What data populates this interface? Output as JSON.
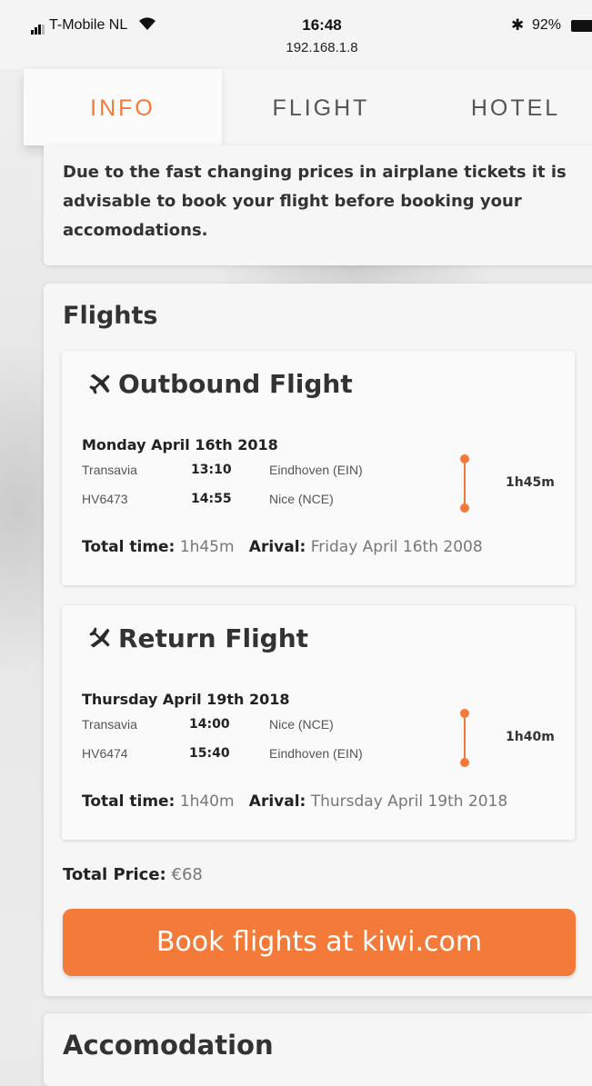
{
  "status_bar": {
    "carrier": "T-Mobile NL",
    "time": "16:48",
    "url": "192.168.1.8",
    "bluetooth": "✱",
    "battery": "92%"
  },
  "tabs": [
    {
      "label": "INFO",
      "active": true
    },
    {
      "label": "FLIGHT",
      "active": false
    },
    {
      "label": "HOTEL",
      "active": false
    }
  ],
  "notice": "Due to the fast changing prices in airplane tickets it is advisable to book your flight before booking your accomodations.",
  "flights_section": {
    "title": "Flights",
    "outbound": {
      "title": "Outbound Flight",
      "icon": "plane-takeoff-icon",
      "date": "Monday April 16th 2018",
      "airline": "Transavia",
      "flight_no": "HV6473",
      "depart_time": "13:10",
      "arrive_time": "14:55",
      "from": "Eindhoven (EIN)",
      "to": "Nice (NCE)",
      "duration": "1h45m",
      "total_label": "Total time:",
      "total_value": "1h45m",
      "arrival_label": "Arival:",
      "arrival_value": "Friday April 16th 2008"
    },
    "return": {
      "title": "Return Flight",
      "icon": "plane-landing-icon",
      "date": "Thursday April 19th 2018",
      "airline": "Transavia",
      "flight_no": "HV6474",
      "depart_time": "14:00",
      "arrive_time": "15:40",
      "from": "Nice (NCE)",
      "to": "Eindhoven (EIN)",
      "duration": "1h40m",
      "total_label": "Total time:",
      "total_value": "1h40m",
      "arrival_label": "Arival:",
      "arrival_value": "Thursday April 19th 2018"
    },
    "price_label": "Total Price:",
    "price_value": "€68",
    "book_button": "Book flights at kiwi.com"
  },
  "accomodation_title": "Accomodation",
  "colors": {
    "accent": "#f47a3a",
    "card": "#f6f6f6"
  }
}
